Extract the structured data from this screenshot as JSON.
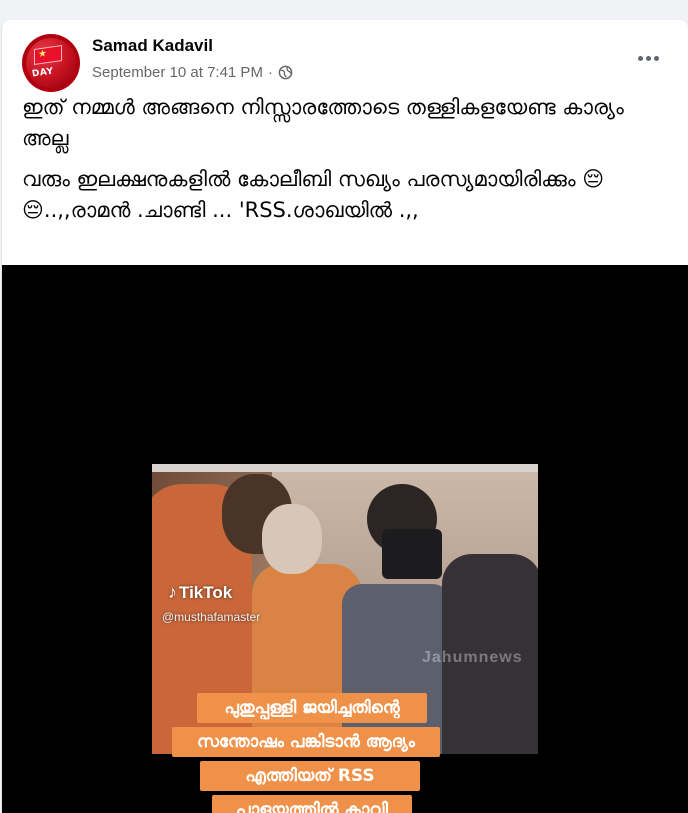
{
  "post": {
    "author": "Samad Kadavil",
    "timestamp": "September 10 at 7:41 PM",
    "separator": "·",
    "privacy_icon": "globe-icon",
    "more_icon": "more-horizontal-icon",
    "text_line_1": "ഇത് നമ്മൾ അങ്ങനെ നിസ്സാരത്തോടെ തള്ളികളയേണ്ട കാര്യം അല്ല",
    "text_line_2": "വരും ഇലക്ഷനുകളിൽ കോലീബി സഖ്യം പരസ്യമായിരിക്കും 😔😔..,,രാമൻ .ചാണ്ടി ... 'RSS.ശാഖയിൽ .,,"
  },
  "avatar": {
    "badge_text": "DAY",
    "brand_color": "#c4101f"
  },
  "video": {
    "platform": "TikTok",
    "handle": "@musthafamaster",
    "watermark": "Jahumnews",
    "captions": [
      "പുതുപ്പള്ളി ജയിച്ചതിന്റെ",
      "സന്തോഷം പങ്കിടാൻ ആദ്യം",
      "എത്തിയത് RSS",
      "പാളയത്തിൽ കാവി",
      ""
    ],
    "caption_color": "#f0914a"
  }
}
